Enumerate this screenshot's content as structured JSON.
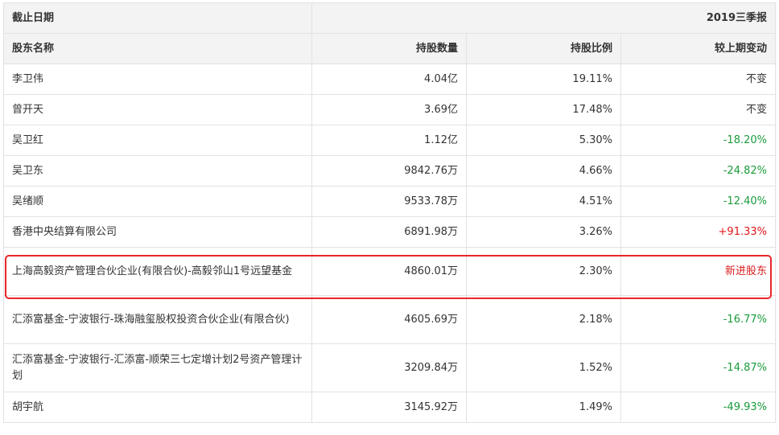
{
  "header": {
    "date_label": "截止日期",
    "period": "2019三季报"
  },
  "columns": {
    "name": "股东名称",
    "shares": "持股数量",
    "ratio": "持股比例",
    "change": "较上期变动"
  },
  "rows": [
    {
      "name": "李卫伟",
      "shares": "4.04亿",
      "ratio": "19.11%",
      "change": "不变",
      "change_type": "neutral"
    },
    {
      "name": "曾开天",
      "shares": "3.69亿",
      "ratio": "17.48%",
      "change": "不变",
      "change_type": "neutral"
    },
    {
      "name": "吴卫红",
      "shares": "1.12亿",
      "ratio": "5.30%",
      "change": "-18.20%",
      "change_type": "neg"
    },
    {
      "name": "吴卫东",
      "shares": "9842.76万",
      "ratio": "4.66%",
      "change": "-24.82%",
      "change_type": "neg"
    },
    {
      "name": "吴绪顺",
      "shares": "9533.78万",
      "ratio": "4.51%",
      "change": "-12.40%",
      "change_type": "neg"
    },
    {
      "name": "香港中央结算有限公司",
      "shares": "6891.98万",
      "ratio": "3.26%",
      "change": "+91.33%",
      "change_type": "pos"
    },
    {
      "name": "上海高毅资产管理合伙企业(有限合伙)-高毅邻山1号远望基金",
      "shares": "4860.01万",
      "ratio": "2.30%",
      "change": "新进股东",
      "change_type": "new"
    },
    {
      "name": "汇添富基金-宁波银行-珠海融玺股权投资合伙企业(有限合伙)",
      "shares": "4605.69万",
      "ratio": "2.18%",
      "change": "-16.77%",
      "change_type": "neg"
    },
    {
      "name": "汇添富基金-宁波银行-汇添富-顺荣三七定增计划2号资产管理计划",
      "shares": "3209.84万",
      "ratio": "1.52%",
      "change": "-14.87%",
      "change_type": "neg"
    },
    {
      "name": "胡宇航",
      "shares": "3145.92万",
      "ratio": "1.49%",
      "change": "-49.93%",
      "change_type": "neg"
    }
  ],
  "highlight_color": "#e8262a",
  "colors": {
    "decrease": "#1a9b3b",
    "increase": "#e0161b",
    "new_holder": "#d81e1e"
  }
}
